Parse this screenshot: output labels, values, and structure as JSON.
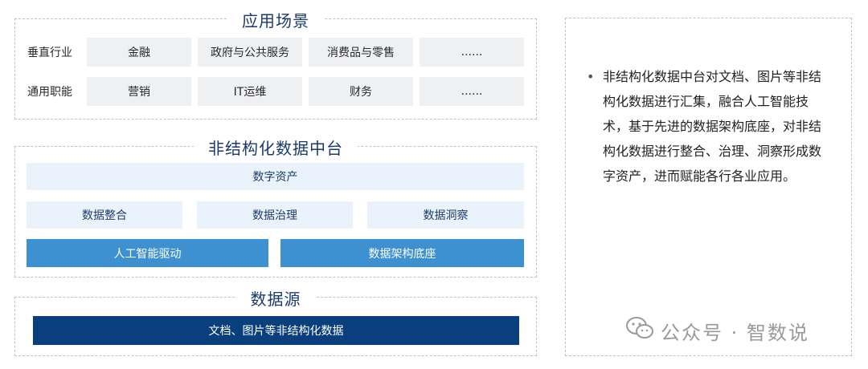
{
  "scenarios": {
    "title": "应用场景",
    "rows": [
      {
        "label": "垂直行业",
        "items": [
          "金融",
          "政府与公共服务",
          "消费品与零售",
          "......"
        ]
      },
      {
        "label": "通用职能",
        "items": [
          "营销",
          "IT运维",
          "财务",
          "......"
        ]
      }
    ]
  },
  "platform": {
    "title": "非结构化数据中台",
    "digital_assets": "数字资产",
    "row1": [
      "数据整合",
      "数据治理",
      "数据洞察"
    ],
    "row2": [
      "人工智能驱动",
      "数据架构底座"
    ]
  },
  "source": {
    "title": "数据源",
    "bar": "文档、图片等非结构化数据"
  },
  "description": {
    "bullet": "•",
    "text": "非结构化数据中台对文档、图片等非结构化数据进行汇集，融合人工智能技术，基于先进的数据架构底座，对非结构化数据进行整合、治理、洞察形成数字资产，进而赋能各行各业应用。"
  },
  "watermark": {
    "text": "公众号 · 智数说",
    "icon": "wechat-icon"
  },
  "colors": {
    "navy": "#083f7c",
    "mid": "#3d91d0",
    "pale": "#eaf3fb",
    "grey": "#eff0f2"
  }
}
